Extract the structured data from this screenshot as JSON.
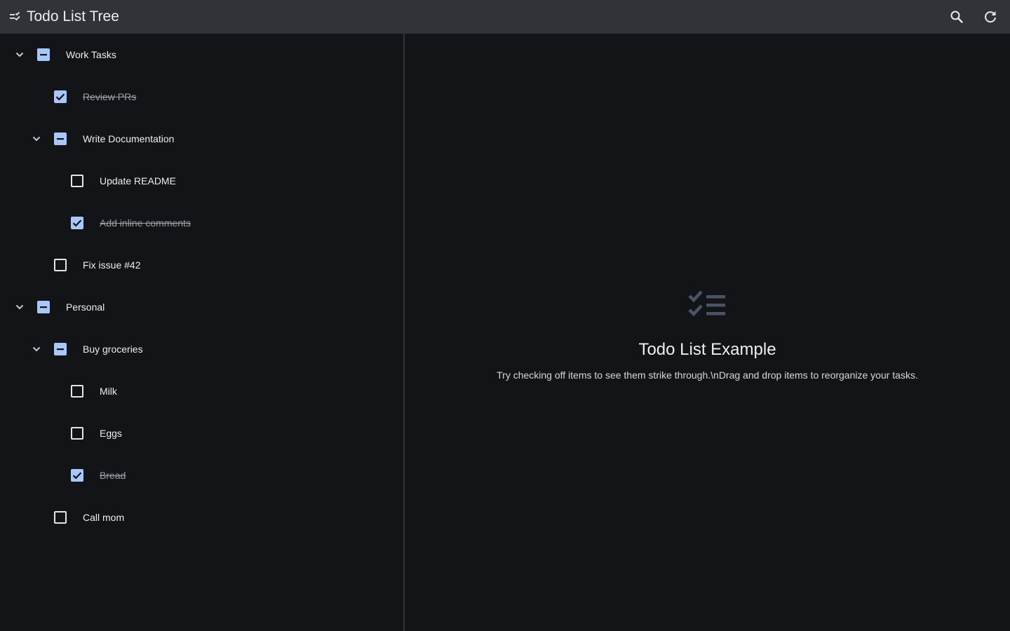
{
  "app": {
    "title": "Todo List Tree"
  },
  "toolbar": {
    "menu_icon": "checklist-icon",
    "search_icon": "search-icon",
    "refresh_icon": "refresh-icon"
  },
  "colors": {
    "appbar": "#303338",
    "background": "#121418",
    "checkbox_accent": "#a8c7fa",
    "empty_icon": "#4a5464"
  },
  "tree": {
    "items": [
      {
        "label": "Work Tasks",
        "level": 0,
        "expandable": true,
        "expanded": true,
        "state": "indeterminate"
      },
      {
        "label": "Review PRs",
        "level": 1,
        "expandable": false,
        "state": "checked"
      },
      {
        "label": "Write Documentation",
        "level": 1,
        "expandable": true,
        "expanded": true,
        "state": "indeterminate"
      },
      {
        "label": "Update README",
        "level": 2,
        "expandable": false,
        "state": "unchecked"
      },
      {
        "label": "Add inline comments",
        "level": 2,
        "expandable": false,
        "state": "checked"
      },
      {
        "label": "Fix issue #42",
        "level": 1,
        "expandable": false,
        "state": "unchecked"
      },
      {
        "label": "Personal",
        "level": 0,
        "expandable": true,
        "expanded": true,
        "state": "indeterminate"
      },
      {
        "label": "Buy groceries",
        "level": 1,
        "expandable": true,
        "expanded": true,
        "state": "indeterminate"
      },
      {
        "label": "Milk",
        "level": 2,
        "expandable": false,
        "state": "unchecked"
      },
      {
        "label": "Eggs",
        "level": 2,
        "expandable": false,
        "state": "unchecked"
      },
      {
        "label": "Bread",
        "level": 2,
        "expandable": false,
        "state": "checked"
      },
      {
        "label": "Call mom",
        "level": 1,
        "expandable": false,
        "state": "unchecked"
      }
    ]
  },
  "empty_state": {
    "icon": "checklist-icon",
    "title": "Todo List Example",
    "subtitle": "Try checking off items to see them strike through.\\nDrag and drop items to reorganize your tasks."
  }
}
